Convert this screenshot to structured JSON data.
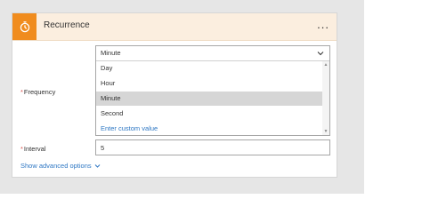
{
  "card": {
    "title": "Recurrence",
    "icon": "stopwatch-icon",
    "menu_label": "..."
  },
  "frequency": {
    "label": "Frequency",
    "selected": "Minute",
    "options": [
      {
        "label": "Day"
      },
      {
        "label": "Hour"
      },
      {
        "label": "Minute"
      },
      {
        "label": "Second"
      },
      {
        "label": "Enter custom value"
      }
    ]
  },
  "interval": {
    "label": "Interval",
    "value": "5"
  },
  "advanced": {
    "label": "Show advanced options"
  },
  "colors": {
    "accent": "#f08c1e",
    "header_bg": "#fbeedf",
    "link": "#2f78c4",
    "selected_row": "#d6d6d6"
  }
}
